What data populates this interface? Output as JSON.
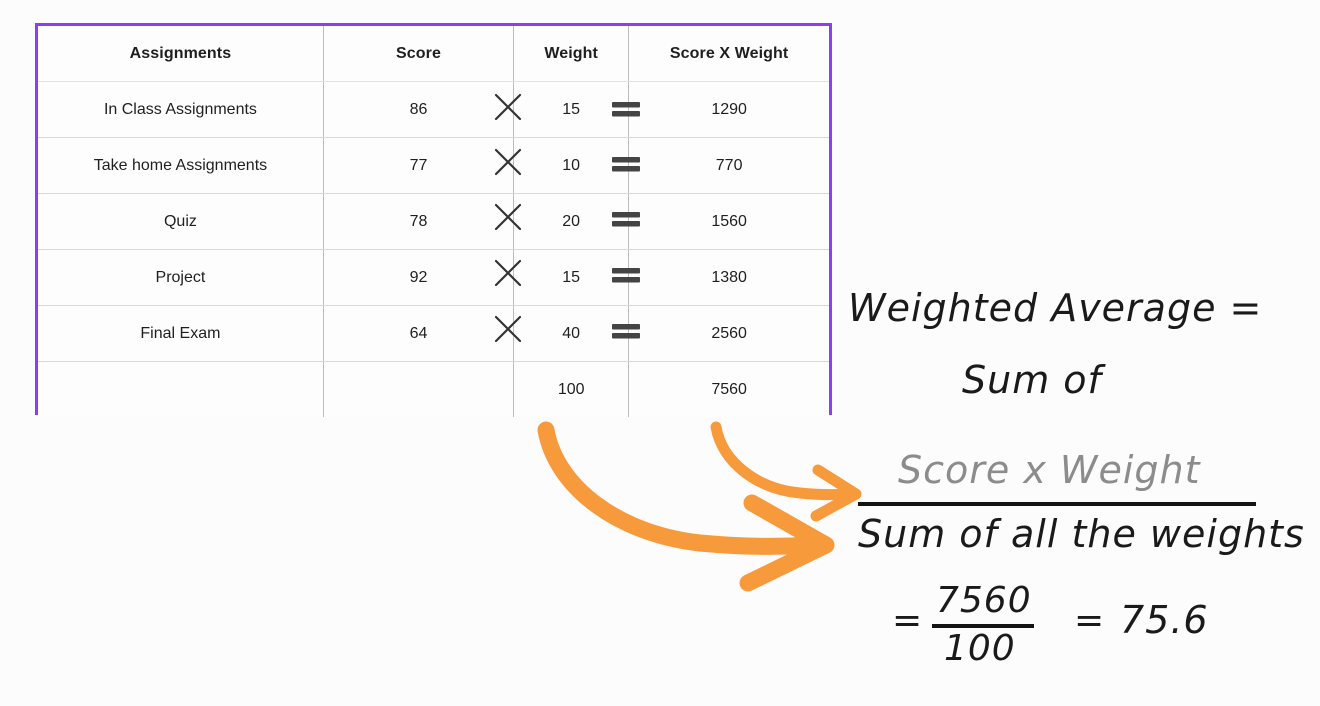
{
  "table": {
    "border_color": "#8b3ff0",
    "headers": [
      "Assignments",
      "Score",
      "Weight",
      "Score X Weight"
    ],
    "rows": [
      {
        "assignment": "In Class Assignments",
        "score": "86",
        "weight": "15",
        "product": "1290"
      },
      {
        "assignment": "Take home Assignments",
        "score": "77",
        "weight": "10",
        "product": "770"
      },
      {
        "assignment": "Quiz",
        "score": "78",
        "weight": "20",
        "product": "1560"
      },
      {
        "assignment": "Project",
        "score": "92",
        "weight": "15",
        "product": "1380"
      },
      {
        "assignment": "Final Exam",
        "score": "64",
        "weight": "40",
        "product": "2560"
      }
    ],
    "total_row": {
      "assignment": "",
      "score": "",
      "weight": "100",
      "product": "7560"
    },
    "operators": {
      "multiply": "×",
      "equals": "="
    }
  },
  "formula": {
    "line1": "Weighted Average =",
    "line2": "Sum of",
    "fraction_numerator": "Score x Weight",
    "fraction_denominator": "Sum of all the weights",
    "equals_1": "=",
    "result_numerator": "7560",
    "result_denominator": "100",
    "equals_2": "=",
    "result": "75.6",
    "numerator_color": "#8c8c8c"
  },
  "arrows": {
    "color": "#f79a3c",
    "count": 2,
    "big_arrow_label": "arrow-sum-of-weights",
    "small_arrow_label": "arrow-score-x-weight"
  },
  "chart_data": {
    "type": "table",
    "title": "Weighted Average Calculation",
    "columns": [
      "Assignments",
      "Score",
      "Weight",
      "Score X Weight"
    ],
    "rows": [
      [
        "In Class Assignments",
        86,
        15,
        1290
      ],
      [
        "Take home Assignments",
        77,
        10,
        770
      ],
      [
        "Quiz",
        78,
        20,
        1560
      ],
      [
        "Project",
        92,
        15,
        1380
      ],
      [
        "Final Exam",
        64,
        40,
        2560
      ],
      [
        "",
        "",
        100,
        7560
      ]
    ],
    "totals": {
      "weight": 100,
      "score_x_weight": 7560
    },
    "weighted_average": 75.6
  }
}
